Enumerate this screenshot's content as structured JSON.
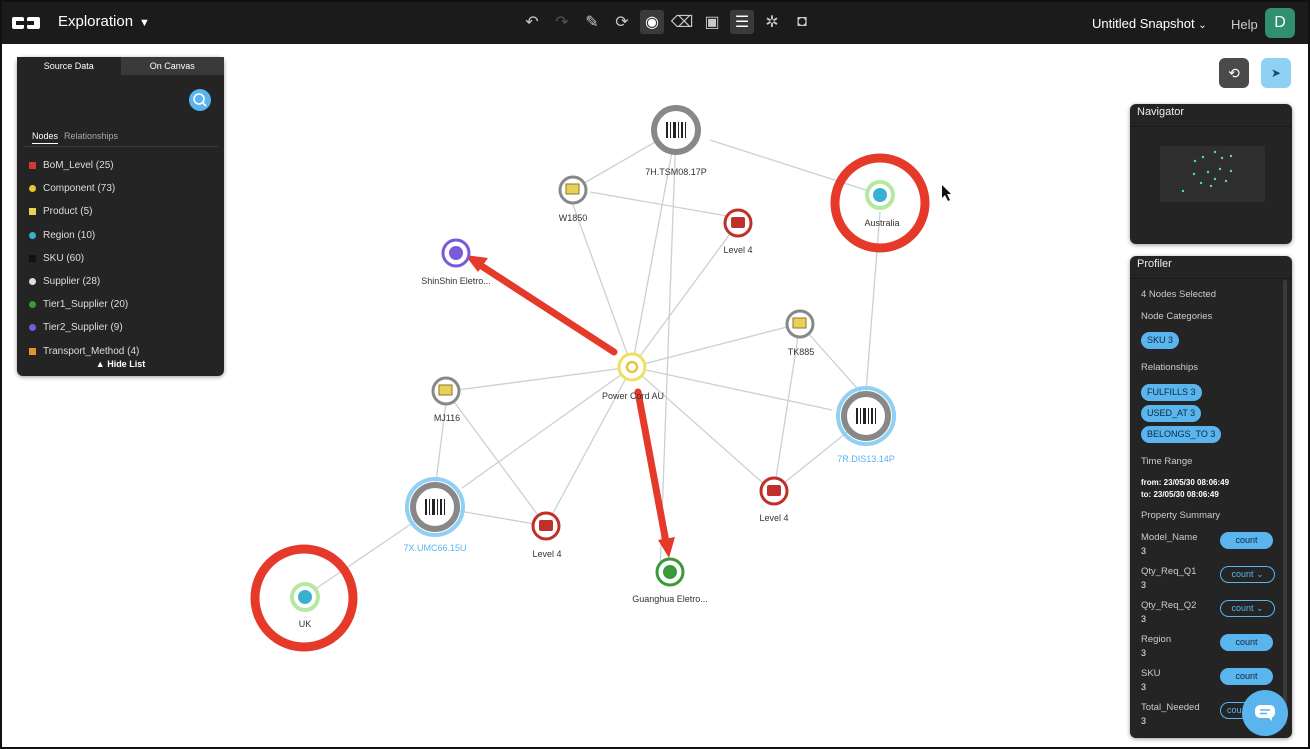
{
  "app": {
    "view_title": "Exploration",
    "snapshot_title": "Untitled Snapshot",
    "help_label": "Help",
    "avatar_initial": "D"
  },
  "toolbar": {
    "icons": [
      "undo-icon",
      "redo-icon",
      "highlight-icon",
      "refresh-layout-icon",
      "select-nodes-icon",
      "clear-selection-icon",
      "image-icon",
      "document-icon",
      "settings-icon",
      "camera-icon"
    ]
  },
  "source_panel": {
    "tabs": [
      "Source Data",
      "On Canvas"
    ],
    "subtabs": [
      "Nodes",
      "Relationships"
    ],
    "items": [
      {
        "label": "BoM_Level (25)",
        "color": "#d03a32"
      },
      {
        "label": "Component (73)",
        "color": "#e8c43a"
      },
      {
        "label": "Product (5)",
        "color": "#e8d05a"
      },
      {
        "label": "Region (10)",
        "color": "#3ab0d0"
      },
      {
        "label": "SKU (60)",
        "color": "#111111"
      },
      {
        "label": "Supplier (28)",
        "color": "#dddddd"
      },
      {
        "label": "Tier1_Supplier (20)",
        "color": "#3a9a3a"
      },
      {
        "label": "Tier2_Supplier (9)",
        "color": "#7a5ad8"
      },
      {
        "label": "Transport_Method (4)",
        "color": "#e8902a"
      }
    ],
    "hide_list": "▲ Hide List"
  },
  "graph": {
    "nodes": [
      {
        "id": "tsm",
        "label": "7H.TSM08.17P",
        "kind": "sku"
      },
      {
        "id": "w1850",
        "label": "W1850",
        "kind": "product"
      },
      {
        "id": "lvl4a",
        "label": "Level 4",
        "kind": "level"
      },
      {
        "id": "australia",
        "label": "Australia",
        "kind": "region"
      },
      {
        "id": "shinshin",
        "label": "ShinShin Eletro...",
        "kind": "tier2"
      },
      {
        "id": "tk885",
        "label": "TK885",
        "kind": "product"
      },
      {
        "id": "power",
        "label": "Power Cord AU",
        "kind": "component"
      },
      {
        "id": "mj116",
        "label": "MJ116",
        "kind": "product"
      },
      {
        "id": "dis",
        "label": "7R.DIS13.14P",
        "kind": "sku-selected"
      },
      {
        "id": "lvl4b",
        "label": "Level 4",
        "kind": "level"
      },
      {
        "id": "umc",
        "label": "7X.UMC66.15U",
        "kind": "sku-selected"
      },
      {
        "id": "lvl4c",
        "label": "Level 4",
        "kind": "level"
      },
      {
        "id": "guanghua",
        "label": "Guanghua Eletro...",
        "kind": "tier1"
      },
      {
        "id": "uk",
        "label": "UK",
        "kind": "region"
      }
    ]
  },
  "navigator": {
    "title": "Navigator"
  },
  "profiler": {
    "title": "Profiler",
    "selected": "4 Nodes Selected",
    "node_categories_label": "Node Categories",
    "node_categories": [
      "SKU 3"
    ],
    "relationships_label": "Relationships",
    "relationships": [
      "FULFILLS 3",
      "USED_AT 3",
      "BELONGS_TO 3"
    ],
    "time_range_label": "Time Range",
    "time_from": "from: 23/05/30 08:06:49",
    "time_to": "to: 23/05/30 08:06:49",
    "property_summary_label": "Property Summary",
    "properties": [
      {
        "name": "Model_Name",
        "value": "3",
        "button": "count",
        "dropdown": false
      },
      {
        "name": "Qty_Req_Q1",
        "value": "3",
        "button": "count",
        "dropdown": true
      },
      {
        "name": "Qty_Req_Q2",
        "value": "3",
        "button": "count",
        "dropdown": true
      },
      {
        "name": "Region",
        "value": "3",
        "button": "count",
        "dropdown": false
      },
      {
        "name": "SKU",
        "value": "3",
        "button": "count",
        "dropdown": false
      },
      {
        "name": "Total_Needed",
        "value": "3",
        "button": "cou",
        "dropdown": false
      }
    ]
  },
  "colors": {
    "accent": "#5ab4ee",
    "annotation_red": "#e53a2a",
    "topbar": "#1b1b1b",
    "panel": "#242424"
  }
}
